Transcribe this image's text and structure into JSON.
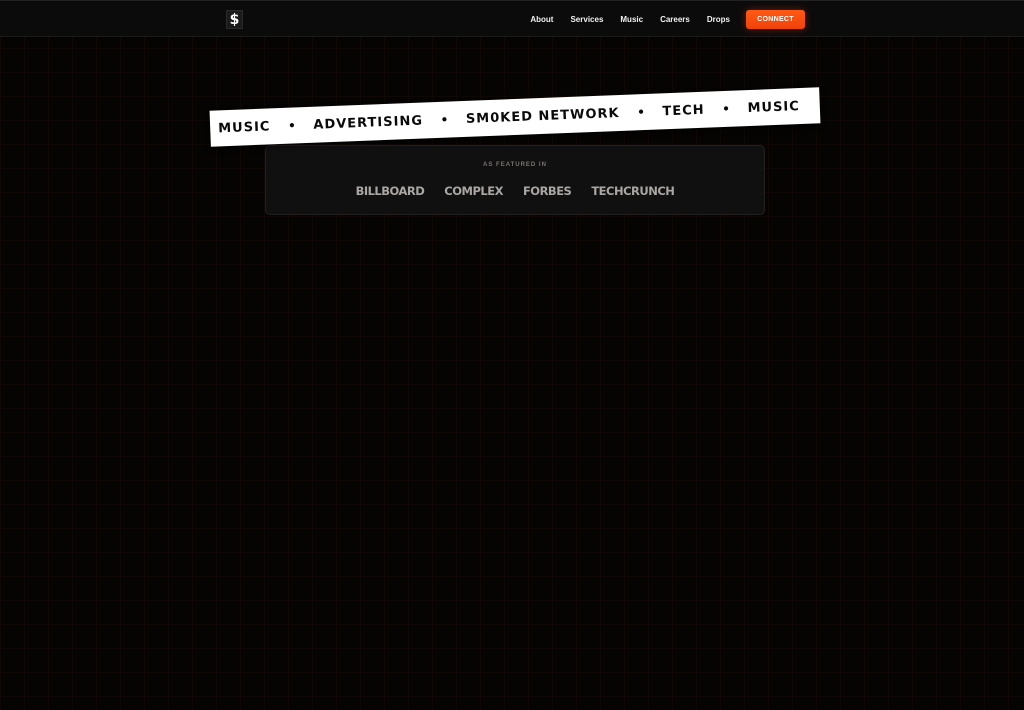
{
  "nav": {
    "logo_glyph": "$",
    "links": [
      "About",
      "Services",
      "Music",
      "Careers",
      "Drops"
    ],
    "connect_label": "CONNECT"
  },
  "ticker": {
    "items": [
      "MUSIC",
      "ADVERTISING",
      "SM0KED NETWORK",
      "TECH",
      "MUSIC"
    ],
    "separator": "•"
  },
  "featured": {
    "label": "AS FEATURED IN",
    "logos": [
      "BILLBOARD",
      "COMPLEX",
      "FORBES",
      "TECHCRUNCH"
    ]
  },
  "colors": {
    "accent": "#ff4e0f",
    "background": "#050403",
    "ticker_bg": "#ffffff"
  }
}
